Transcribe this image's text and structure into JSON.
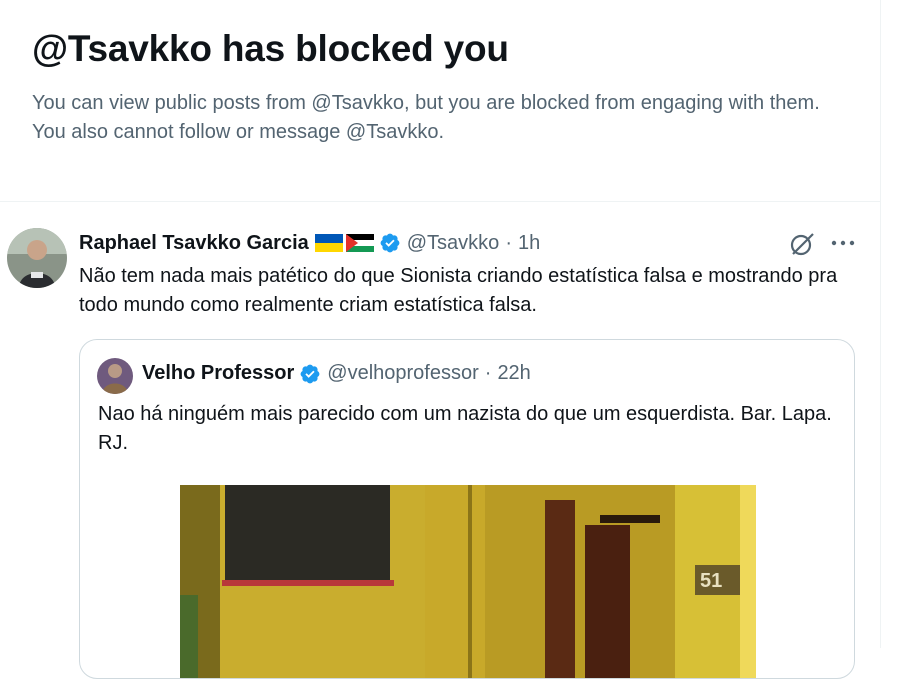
{
  "blocked": {
    "title": "@Tsavkko has blocked you",
    "description": "You can view public posts from @Tsavkko, but you are blocked from engaging with them. You also cannot follow or message @Tsavkko."
  },
  "post": {
    "author_name": "Raphael Tsavkko Garcia",
    "flags": [
      "ukraine-flag",
      "palestine-flag"
    ],
    "handle": "@Tsavkko",
    "separator": "·",
    "time": "1h",
    "text": "Não tem nada mais patético do que Sionista criando estatística falsa e mostrando pra todo mundo como realmente criam estatística falsa.",
    "icons": {
      "grok": "grok-icon",
      "more": "more-icon",
      "verified": "verified-badge-icon"
    }
  },
  "quote": {
    "author_name": "Velho Professor",
    "handle": "@velhoprofessor",
    "separator": "·",
    "time": "22h",
    "text": "Nao há ninguém mais parecido com um nazista do que um esquerdista. Bar. Lapa. RJ."
  },
  "colors": {
    "text_primary": "#0f1419",
    "text_secondary": "#536471",
    "border": "#cfd9de",
    "verified": "#1d9bf0"
  }
}
